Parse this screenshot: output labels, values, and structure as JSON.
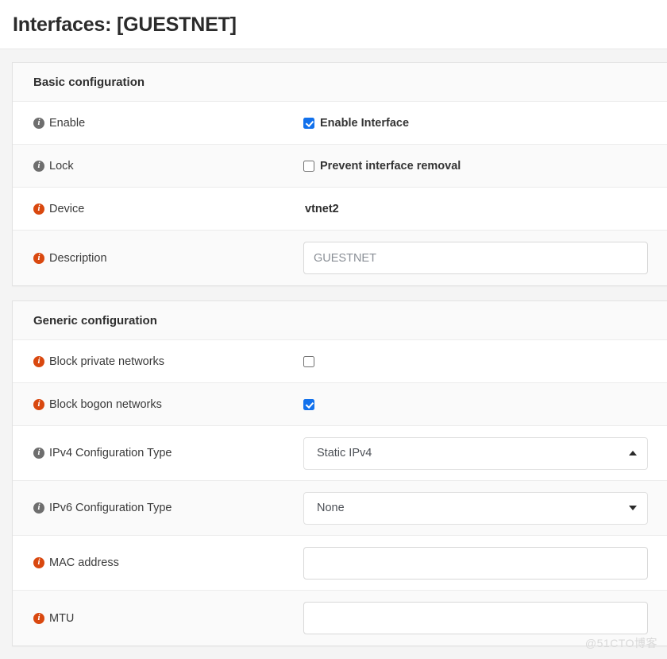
{
  "page": {
    "title": "Interfaces: [GUESTNET]",
    "watermark": "@51CTO博客"
  },
  "basic_configuration": {
    "header": "Basic configuration",
    "rows": [
      {
        "label": "Enable",
        "icon_color": "gray",
        "checkbox_label": "Enable Interface",
        "checked": true
      },
      {
        "label": "Lock",
        "icon_color": "gray",
        "checkbox_label": "Prevent interface removal",
        "checked": false
      },
      {
        "label": "Device",
        "icon_color": "orange",
        "value": "vtnet2"
      },
      {
        "label": "Description",
        "icon_color": "orange",
        "input_value": "GUESTNET",
        "placeholder": "GUESTNET"
      }
    ]
  },
  "generic_configuration": {
    "header": "Generic configuration",
    "rows": [
      {
        "label": "Block private networks",
        "icon_color": "orange",
        "checked": false
      },
      {
        "label": "Block bogon networks",
        "icon_color": "orange",
        "checked": true
      },
      {
        "label": "IPv4 Configuration Type",
        "icon_color": "gray",
        "selected": "Static IPv4",
        "caret": "up"
      },
      {
        "label": "IPv6 Configuration Type",
        "icon_color": "gray",
        "selected": "None",
        "caret": "down"
      },
      {
        "label": "MAC address",
        "icon_color": "orange",
        "input_value": "",
        "placeholder": ""
      },
      {
        "label": "MTU",
        "icon_color": "orange",
        "input_value": "",
        "placeholder": ""
      }
    ]
  },
  "colors": {
    "accent_checkbox": "#1271ec",
    "info_orange": "#d9480f",
    "info_gray": "#6e6e6e",
    "page_background": "#f4f4f4"
  }
}
